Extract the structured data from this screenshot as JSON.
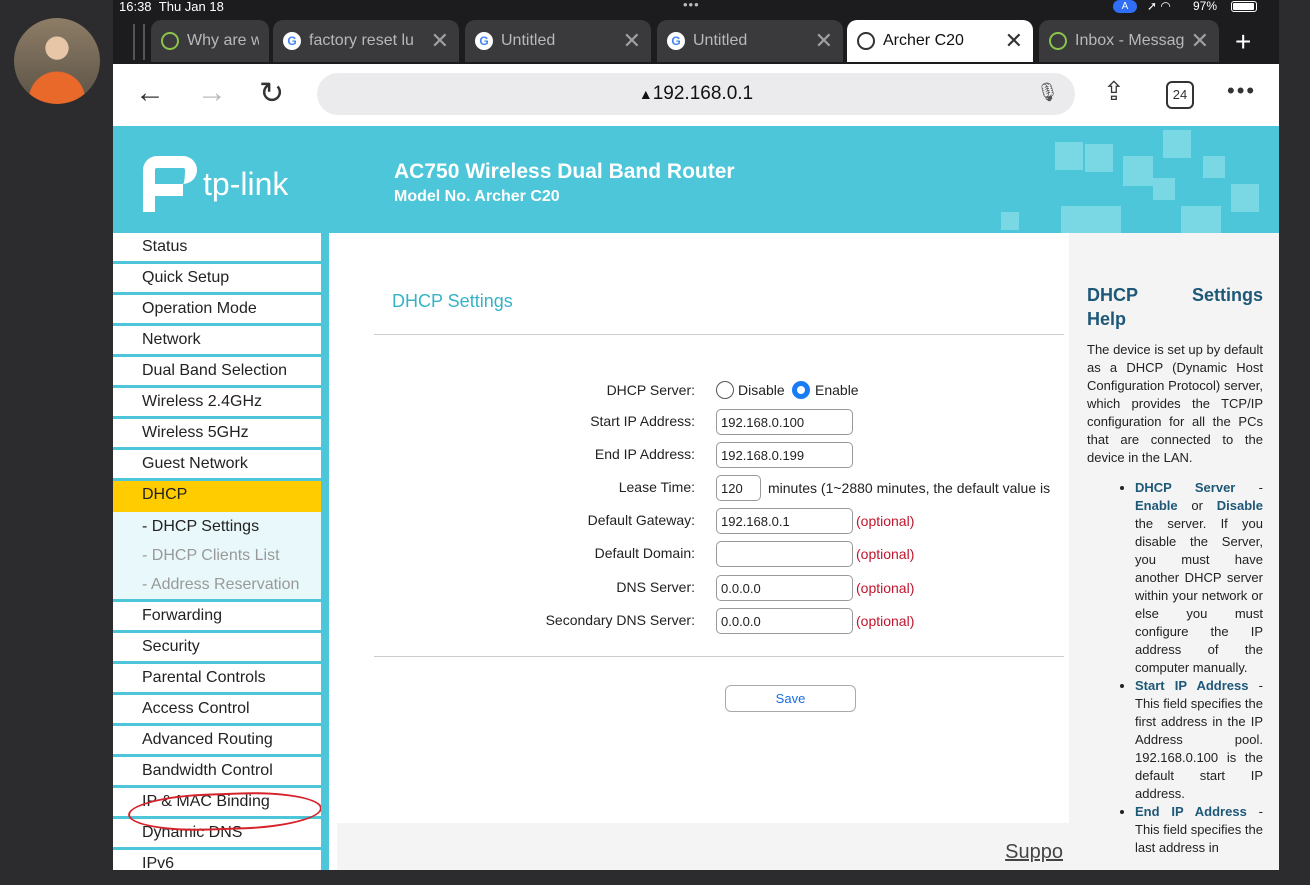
{
  "status_bar": {
    "time": "16:38",
    "date": "Thu Jan 18",
    "battery": "97%"
  },
  "tabs": [
    {
      "title": "Why are w",
      "icon": "green-circle-icon",
      "active": false
    },
    {
      "title": "factory reset lu",
      "icon": "google-icon",
      "active": false
    },
    {
      "title": "Untitled",
      "icon": "google-icon",
      "active": false
    },
    {
      "title": "Untitled",
      "icon": "google-icon",
      "active": false
    },
    {
      "title": "Archer C20",
      "icon": "globe-icon",
      "active": true
    },
    {
      "title": "Inbox - Messag",
      "icon": "green-circle-icon",
      "active": false
    }
  ],
  "toolbar": {
    "url": "192.168.0.1",
    "tab_count": "24"
  },
  "router": {
    "logo": "tp-link",
    "title": "AC750 Wireless Dual Band Router",
    "model": "Model No. Archer C20"
  },
  "sidebar": {
    "items": [
      "Status",
      "Quick Setup",
      "Operation Mode",
      "Network",
      "Dual Band Selection",
      "Wireless 2.4GHz",
      "Wireless 5GHz",
      "Guest Network",
      "DHCP"
    ],
    "sub_items": [
      "- DHCP Settings",
      "- DHCP Clients List",
      "- Address Reservation"
    ],
    "items_after": [
      "Forwarding",
      "Security",
      "Parental Controls",
      "Access Control",
      "Advanced Routing",
      "Bandwidth Control",
      "IP & MAC Binding",
      "Dynamic DNS",
      "IPv6"
    ],
    "active": "DHCP"
  },
  "form": {
    "page_title": "DHCP Settings",
    "dhcp_server_label": "DHCP Server:",
    "disable_label": "Disable",
    "enable_label": "Enable",
    "dhcp_server_value": "Enable",
    "start_ip_label": "Start IP Address:",
    "start_ip": "192.168.0.100",
    "end_ip_label": "End IP Address:",
    "end_ip": "192.168.0.199",
    "lease_label": "Lease Time:",
    "lease": "120",
    "lease_note": "minutes (1~2880 minutes, the default value is",
    "gateway_label": "Default Gateway:",
    "gateway": "192.168.0.1",
    "domain_label": "Default Domain:",
    "domain": "",
    "dns_label": "DNS Server:",
    "dns": "0.0.0.0",
    "dns2_label": "Secondary DNS Server:",
    "dns2": "0.0.0.0",
    "optional": "(optional)",
    "save": "Save",
    "support": "Suppo"
  },
  "help": {
    "title_left": "DHCP",
    "title_right": "Settings",
    "title_line2": "Help",
    "intro": "The device is set up by default as a DHCP (Dynamic Host Configuration Protocol) server, which provides the TCP/IP configuration for all the PCs that are connected to the device in the LAN.",
    "b1_term": "DHCP Server",
    "b1_enable": "Enable",
    "b1_or": "or",
    "b1_disable": "Disable",
    "b1_text": "the server. If you disable the Server, you must have another DHCP server within your network or else you must configure the IP address of the computer manually.",
    "b2_term": "Start IP Address",
    "b2_text": "This field specifies the first address in the IP Address pool. 192.168.0.100 is the default start IP address.",
    "b3_term": "End IP Address",
    "b3_text": "This field specifies the last address in"
  },
  "colors": {
    "accent": "#4cc6d8",
    "active_menu": "#ffcc00",
    "annotation": "#d6232a",
    "optional": "#c0152d"
  }
}
